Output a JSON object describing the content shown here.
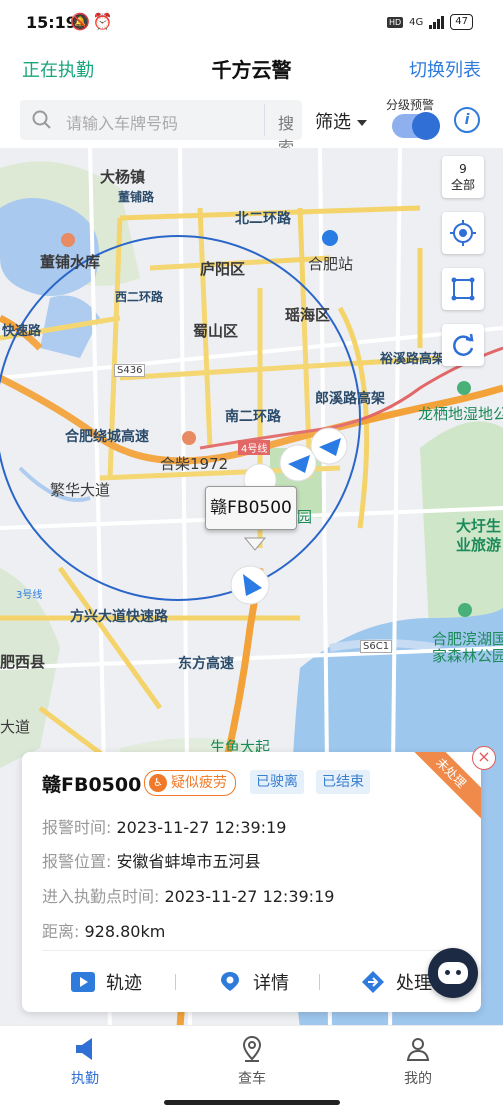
{
  "status_bar": {
    "time": "15:19",
    "network": "4G",
    "hd": "HD",
    "battery": "47"
  },
  "header": {
    "left_link": "正在执勤",
    "title": "千方云警",
    "right_link": "切换列表"
  },
  "search": {
    "placeholder": "请输入车牌号码",
    "button": "搜索",
    "filter_label": "筛选",
    "grade_warning_label": "分级预警",
    "grade_warning_on": true
  },
  "map": {
    "controls": {
      "count": "9",
      "count_label": "全部"
    },
    "labels": {
      "dayang": "大杨镇",
      "dongpu": "董铺水库",
      "luyang": "庐阳区",
      "hefei_station": "合肥站",
      "yaohai": "瑶海区",
      "shushan": "蜀山区",
      "nan_er_huan": "南二环路",
      "lanxi": "郎溪路高架",
      "heifei_ring": "合肥绕城高速",
      "hechai": "合柴1972",
      "fanhua": "繁华大道",
      "fangxing": "方兴大道快速路",
      "dongfang": "东方高速",
      "longqi": "龙栖地湿地公",
      "dayu": "大圩生",
      "yelv": "业旅游",
      "hefei_binhu": "合肥滨湖国",
      "jiasen": "家森林公园",
      "feixi": "肥西县",
      "daqiao": "大道",
      "north_er_huan": "北二环路",
      "xi_er_huan": "西二环路",
      "dongpu_road": "董铺路",
      "yuxi": "裕溪路高架桥",
      "kuaisu": "快速路",
      "s436": "S436",
      "s6c1": "S6C1",
      "line3": "3号线",
      "line4": "4号线",
      "yangpo": "央公园",
      "shengyu": "生鱼大起"
    },
    "popup_plate": "赣FB0500"
  },
  "card": {
    "plate": "赣FB0500",
    "tag_fatigue": "疑似疲劳",
    "tag_left": "已驶离",
    "tag_ended": "已结束",
    "ribbon": "未处理",
    "alarm_time_label": "报警时间:",
    "alarm_time": "2023-11-27 12:39:19",
    "alarm_location_label": "报警位置:",
    "alarm_location": "安徽省蚌埠市五河县",
    "enter_time_label": "进入执勤点时间:",
    "enter_time": "2023-11-27 12:39:19",
    "distance_label": "距离:",
    "distance": "928.80km",
    "action_track": "轨迹",
    "action_detail": "详情",
    "action_handle": "处理"
  },
  "nav": {
    "duty": "执勤",
    "check_car": "查车",
    "mine": "我的"
  },
  "colors": {
    "accent_green": "#18a67a",
    "accent_blue": "#2f6fd6",
    "warn_orange": "#f07a2a"
  }
}
